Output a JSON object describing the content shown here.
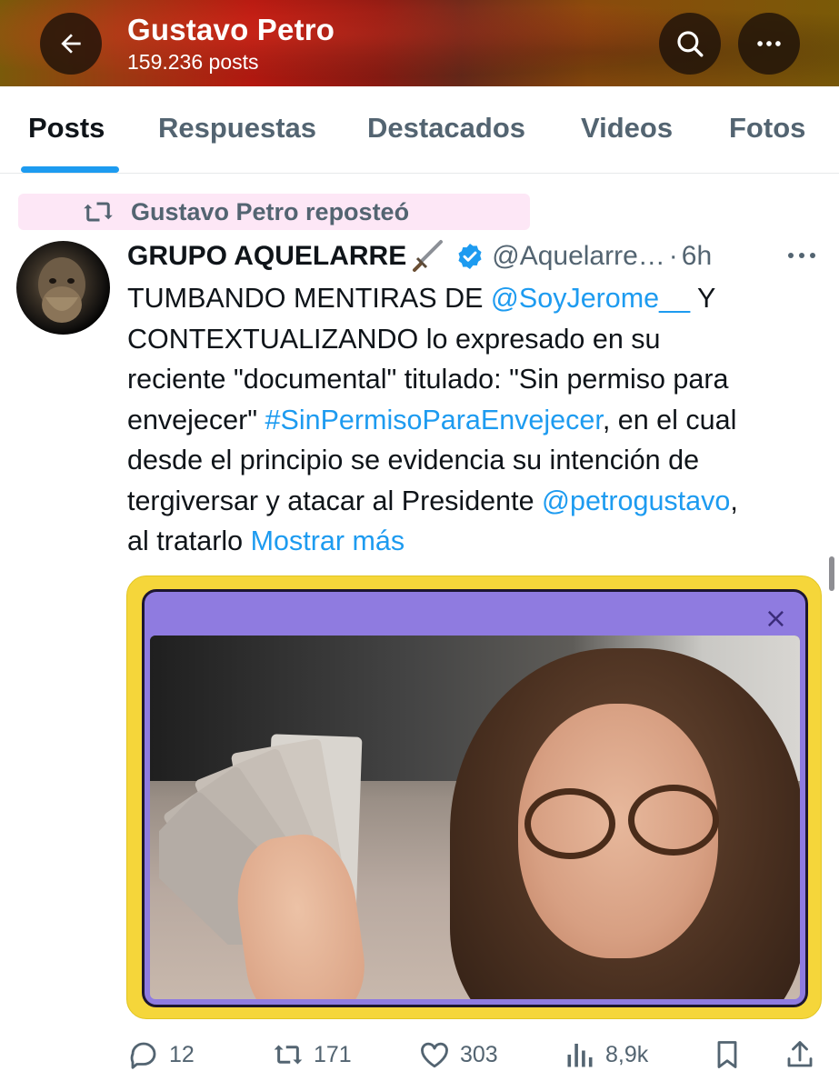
{
  "header": {
    "title": "Gustavo Petro",
    "post_count": "159.236 posts",
    "back_icon": "arrow-left-icon",
    "search_icon": "search-icon",
    "more_icon": "more-horizontal-icon"
  },
  "tabs": [
    {
      "label": "Posts",
      "active": true
    },
    {
      "label": "Respuestas",
      "active": false
    },
    {
      "label": "Destacados",
      "active": false
    },
    {
      "label": "Videos",
      "active": false
    },
    {
      "label": "Fotos",
      "active": false
    }
  ],
  "repost": {
    "label": "Gustavo Petro reposteó",
    "icon": "repost-icon"
  },
  "tweet": {
    "author_name": "GRUPO AQUELARRE",
    "author_emoji": "dagger-icon",
    "verified": true,
    "handle": "@Aquelarre…",
    "separator": "·",
    "time": "6h",
    "text_lines": [
      [
        {
          "t": "TUMBANDO MENTIRAS DE "
        },
        {
          "t": "@SoyJerome__",
          "link": true
        },
        {
          "t": " Y"
        }
      ],
      [
        {
          "t": "CONTEXTUALIZANDO lo expresado en su"
        }
      ],
      [
        {
          "t": "reciente \"documental\" titulado: \"Sin permiso para"
        }
      ],
      [
        {
          "t": "envejecer\" "
        },
        {
          "t": "#SinPermisoParaEnvejecer",
          "link": true
        },
        {
          "t": ", en el cual"
        }
      ],
      [
        {
          "t": "desde el principio se evidencia su intención de"
        }
      ],
      [
        {
          "t": "tergiversar y atacar al Presidente "
        },
        {
          "t": "@petrogustavo",
          "link": true
        },
        {
          "t": ","
        }
      ],
      [
        {
          "t": "al tratarlo "
        },
        {
          "t": "Mostrar más",
          "link": true
        }
      ]
    ],
    "media": {
      "close_glyph": "×"
    }
  },
  "actions": {
    "replies": "12",
    "reposts": "171",
    "likes": "303",
    "views": "8,9k",
    "bookmark_icon": "bookmark-icon",
    "share_icon": "share-icon"
  },
  "colors": {
    "accent": "#1d9bf0",
    "text_primary": "#0f1419",
    "text_secondary": "#536471",
    "repost_highlight": "#fde7f6",
    "media_frame": "#f5d63a",
    "media_window": "#8f7be0"
  }
}
